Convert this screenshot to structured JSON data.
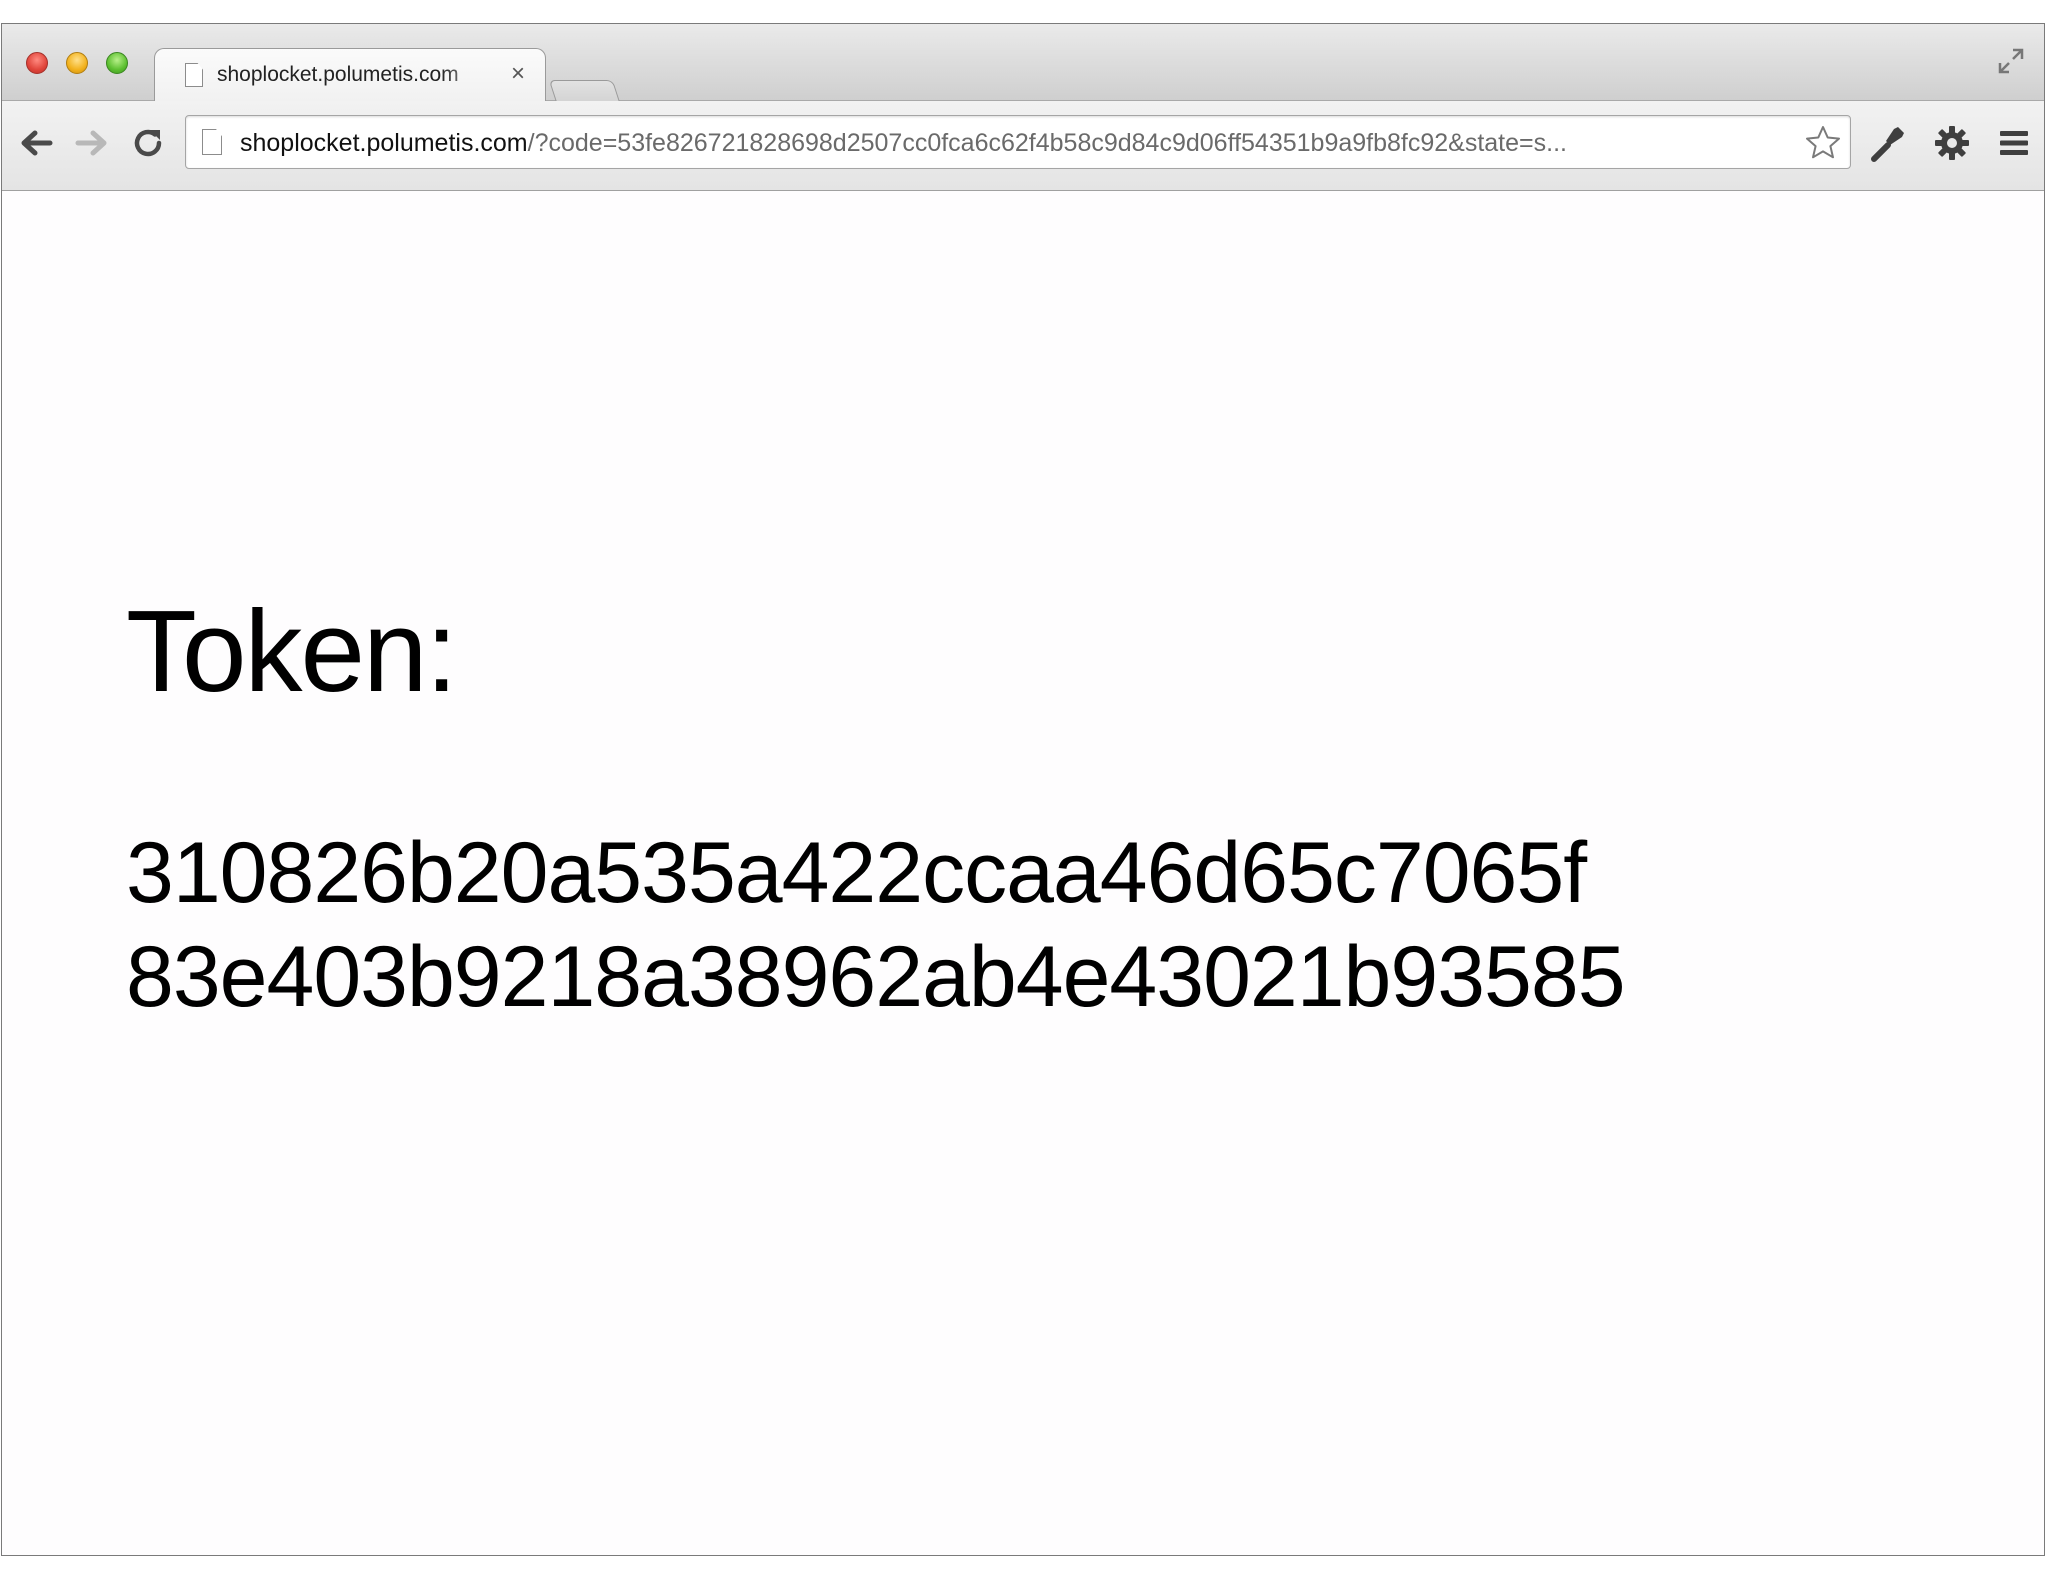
{
  "browser": {
    "tab": {
      "title": "shoplocket.polumetis.com",
      "close_glyph": "×"
    },
    "address_bar": {
      "host": "shoplocket.polumetis.com",
      "rest": "/?code=53fe826721828698d2507cc0fca6c62f4b58c9d84c9d06ff54351b9a9fb8fc92&state=s..."
    },
    "icons": {
      "back": "back-arrow-icon",
      "forward": "forward-arrow-icon",
      "reload": "reload-icon",
      "bookmark": "star-icon",
      "wrench": "wrench-icon",
      "settings": "gear-icon",
      "menu": "menu-icon",
      "fullscreen": "fullscreen-icon"
    }
  },
  "page": {
    "token_label": "Token:",
    "token_line_1": "310826b20a535a422ccaa46d65c7065f",
    "token_line_2": "83e403b9218a38962ab4e43021b93585"
  }
}
